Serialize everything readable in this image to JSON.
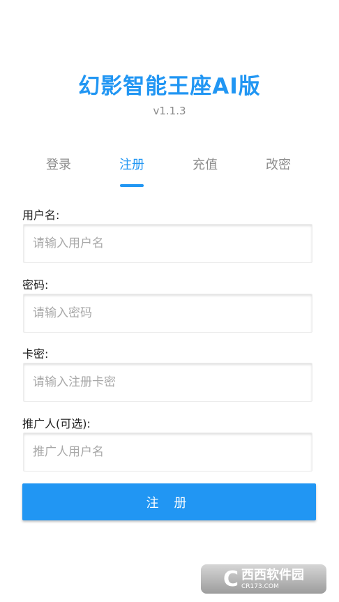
{
  "app": {
    "title": "幻影智能王座AI版",
    "version": "v1.1.3"
  },
  "tabs": [
    {
      "label": "登录",
      "active": false
    },
    {
      "label": "注册",
      "active": true
    },
    {
      "label": "充值",
      "active": false
    },
    {
      "label": "改密",
      "active": false
    }
  ],
  "form": {
    "username": {
      "label": "用户名:",
      "placeholder": "请输入用户名",
      "value": ""
    },
    "password": {
      "label": "密码:",
      "placeholder": "请输入密码",
      "value": ""
    },
    "card_key": {
      "label": "卡密:",
      "placeholder": "请输入注册卡密",
      "value": ""
    },
    "referrer": {
      "label": "推广人(可选):",
      "placeholder": "推广人用户名",
      "value": ""
    },
    "submit_label": "注 册"
  },
  "watermark": {
    "mark": "C",
    "name": "西西软件园",
    "site": "CR173.COM"
  },
  "colors": {
    "accent": "#2196f3",
    "muted_text": "#8c8c8c"
  }
}
